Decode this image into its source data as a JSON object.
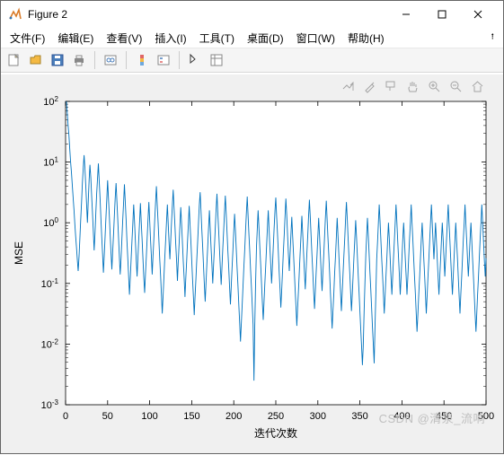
{
  "window": {
    "title": "Figure 2"
  },
  "menu": {
    "file": "文件(F)",
    "edit": "编辑(E)",
    "view": "查看(V)",
    "insert": "插入(I)",
    "tools": "工具(T)",
    "desktop": "桌面(D)",
    "window": "窗口(W)",
    "help": "帮助(H)"
  },
  "watermark": "CSDN @清泉_流响",
  "chart_data": {
    "type": "line",
    "xlabel": "迭代次数",
    "ylabel": "MSE",
    "xlim": [
      0,
      500
    ],
    "ylim_log10": [
      -3,
      2
    ],
    "yticks_log10": [
      -3,
      -2,
      -1,
      0,
      1,
      2
    ],
    "ytick_labels": [
      "10^{-3}",
      "10^{-2}",
      "10^{-1}",
      "10^{0}",
      "10^{1}",
      "10^{2}"
    ],
    "xticks": [
      0,
      50,
      100,
      150,
      200,
      250,
      300,
      350,
      400,
      450,
      500
    ],
    "line_color": "#0072BD",
    "series": {
      "name": "MSE",
      "x": [
        1,
        2,
        3,
        4,
        5,
        6,
        7,
        8,
        9,
        10,
        11,
        12,
        13,
        14,
        15,
        16,
        17,
        18,
        19,
        20,
        21,
        22,
        23,
        24,
        25,
        26,
        27,
        28,
        29,
        30,
        31,
        32,
        33,
        34,
        35,
        36,
        37,
        38,
        39,
        40,
        41,
        42,
        43,
        44,
        45,
        46,
        47,
        48,
        49,
        50,
        51,
        52,
        53,
        54,
        55,
        56,
        57,
        58,
        59,
        60,
        61,
        62,
        63,
        64,
        65,
        66,
        67,
        68,
        69,
        70,
        71,
        72,
        73,
        74,
        75,
        76,
        77,
        78,
        79,
        80,
        81,
        82,
        83,
        84,
        85,
        86,
        87,
        88,
        89,
        90,
        91,
        92,
        93,
        94,
        95,
        96,
        97,
        98,
        99,
        100,
        101,
        102,
        103,
        104,
        105,
        106,
        107,
        108,
        109,
        110,
        111,
        112,
        113,
        114,
        115,
        116,
        117,
        118,
        119,
        120,
        121,
        122,
        123,
        124,
        125,
        126,
        127,
        128,
        129,
        130,
        131,
        132,
        133,
        134,
        135,
        136,
        137,
        138,
        139,
        140,
        141,
        142,
        143,
        144,
        145,
        146,
        147,
        148,
        149,
        150,
        151,
        152,
        153,
        154,
        155,
        156,
        157,
        158,
        159,
        160,
        161,
        162,
        163,
        164,
        165,
        166,
        167,
        168,
        169,
        170,
        171,
        172,
        173,
        174,
        175,
        176,
        177,
        178,
        179,
        180,
        181,
        182,
        183,
        184,
        185,
        186,
        187,
        188,
        189,
        190,
        191,
        192,
        193,
        194,
        195,
        196,
        197,
        198,
        199,
        200,
        201,
        202,
        203,
        204,
        205,
        206,
        207,
        208,
        209,
        210,
        211,
        212,
        213,
        214,
        215,
        216,
        217,
        218,
        219,
        220,
        221,
        222,
        223,
        224,
        225,
        226,
        227,
        228,
        229,
        230,
        231,
        232,
        233,
        234,
        235,
        236,
        237,
        238,
        239,
        240,
        241,
        242,
        243,
        244,
        245,
        246,
        247,
        248,
        249,
        250,
        251,
        252,
        253,
        254,
        255,
        256,
        257,
        258,
        259,
        260,
        261,
        262,
        263,
        264,
        265,
        266,
        267,
        268,
        269,
        270,
        271,
        272,
        273,
        274,
        275,
        276,
        277,
        278,
        279,
        280,
        281,
        282,
        283,
        284,
        285,
        286,
        287,
        288,
        289,
        290,
        291,
        292,
        293,
        294,
        295,
        296,
        297,
        298,
        299,
        300,
        301,
        302,
        303,
        304,
        305,
        306,
        307,
        308,
        309,
        310,
        311,
        312,
        313,
        314,
        315,
        316,
        317,
        318,
        319,
        320,
        321,
        322,
        323,
        324,
        325,
        326,
        327,
        328,
        329,
        330,
        331,
        332,
        333,
        334,
        335,
        336,
        337,
        338,
        339,
        340,
        341,
        342,
        343,
        344,
        345,
        346,
        347,
        348,
        349,
        350,
        351,
        352,
        353,
        354,
        355,
        356,
        357,
        358,
        359,
        360,
        361,
        362,
        363,
        364,
        365,
        366,
        367,
        368,
        369,
        370,
        371,
        372,
        373,
        374,
        375,
        376,
        377,
        378,
        379,
        380,
        381,
        382,
        383,
        384,
        385,
        386,
        387,
        388,
        389,
        390,
        391,
        392,
        393,
        394,
        395,
        396,
        397,
        398,
        399,
        400,
        401,
        402,
        403,
        404,
        405,
        406,
        407,
        408,
        409,
        410,
        411,
        412,
        413,
        414,
        415,
        416,
        417,
        418,
        419,
        420,
        421,
        422,
        423,
        424,
        425,
        426,
        427,
        428,
        429,
        430,
        431,
        432,
        433,
        434,
        435,
        436,
        437,
        438,
        439,
        440,
        441,
        442,
        443,
        444,
        445,
        446,
        447,
        448,
        449,
        450,
        451,
        452,
        453,
        454,
        455,
        456,
        457,
        458,
        459,
        460,
        461,
        462,
        463,
        464,
        465,
        466,
        467,
        468,
        469,
        470,
        471,
        472,
        473,
        474,
        475,
        476,
        477,
        478,
        479,
        480,
        481,
        482,
        483,
        484,
        485,
        486,
        487,
        488,
        489,
        490,
        491,
        492,
        493,
        494,
        495,
        496,
        497,
        498,
        499,
        500
      ],
      "y": [
        100,
        62,
        40,
        28,
        16,
        10,
        6.5,
        4.1,
        2.6,
        1.6,
        0.95,
        0.6,
        0.38,
        0.24,
        0.16,
        0.28,
        0.55,
        1.1,
        2.2,
        4.5,
        8.2,
        13,
        8.0,
        4.0,
        2.0,
        1.0,
        2.4,
        5.0,
        9.0,
        5.5,
        2.8,
        1.4,
        0.7,
        0.35,
        0.7,
        1.5,
        3.0,
        5.5,
        9.5,
        5.0,
        2.5,
        1.2,
        0.6,
        0.3,
        0.15,
        0.3,
        0.6,
        1.2,
        2.5,
        5.0,
        2.6,
        1.3,
        0.65,
        0.33,
        0.17,
        0.33,
        0.65,
        1.3,
        2.5,
        4.5,
        2.3,
        1.2,
        0.55,
        0.27,
        0.14,
        0.27,
        0.55,
        1.1,
        2.2,
        4.3,
        2.1,
        1.1,
        0.5,
        0.25,
        0.13,
        0.065,
        0.13,
        0.26,
        0.5,
        1.0,
        2.0,
        1.0,
        0.5,
        0.25,
        0.13,
        0.26,
        0.52,
        1.05,
        2.1,
        1.05,
        0.52,
        0.26,
        0.13,
        0.07,
        0.14,
        0.28,
        0.56,
        1.1,
        2.2,
        1.1,
        0.55,
        0.28,
        0.14,
        0.28,
        0.56,
        1.1,
        2.2,
        4.0,
        2.0,
        1.0,
        0.5,
        0.25,
        0.13,
        0.065,
        0.032,
        0.065,
        0.13,
        0.26,
        0.52,
        1.0,
        2.0,
        1.0,
        0.5,
        0.25,
        0.5,
        1.0,
        2.0,
        3.5,
        1.8,
        0.9,
        0.45,
        0.23,
        0.11,
        0.23,
        0.46,
        0.92,
        1.8,
        0.92,
        0.46,
        0.23,
        0.12,
        0.06,
        0.12,
        0.24,
        0.48,
        0.96,
        1.9,
        0.96,
        0.48,
        0.24,
        0.12,
        0.06,
        0.03,
        0.06,
        0.12,
        0.24,
        0.48,
        0.96,
        1.9,
        3.2,
        1.6,
        0.8,
        0.4,
        0.2,
        0.1,
        0.05,
        0.1,
        0.2,
        0.4,
        0.8,
        1.6,
        0.8,
        0.4,
        0.2,
        0.1,
        0.2,
        0.4,
        0.8,
        1.6,
        3.0,
        1.5,
        0.74,
        0.37,
        0.19,
        0.095,
        0.19,
        0.38,
        0.76,
        1.5,
        2.8,
        1.4,
        0.7,
        0.35,
        0.18,
        0.09,
        0.045,
        0.09,
        0.18,
        0.36,
        0.72,
        1.4,
        0.72,
        0.36,
        0.18,
        0.09,
        0.045,
        0.022,
        0.011,
        0.022,
        0.045,
        0.09,
        0.18,
        0.36,
        0.72,
        1.4,
        2.7,
        1.35,
        0.68,
        0.34,
        0.17,
        0.085,
        0.043,
        0.021,
        0.0025,
        0.021,
        0.1,
        0.4,
        0.8,
        1.6,
        0.8,
        0.4,
        0.2,
        0.1,
        0.05,
        0.025,
        0.05,
        0.1,
        0.2,
        0.4,
        0.8,
        1.6,
        0.8,
        0.4,
        0.2,
        0.1,
        0.2,
        0.4,
        0.8,
        1.6,
        2.6,
        1.3,
        0.65,
        0.33,
        0.16,
        0.08,
        0.04,
        0.08,
        0.16,
        0.33,
        0.65,
        1.3,
        2.5,
        1.3,
        0.62,
        0.31,
        0.16,
        0.31,
        0.62,
        1.25,
        0.62,
        0.31,
        0.16,
        0.08,
        0.04,
        0.02,
        0.04,
        0.08,
        0.16,
        0.32,
        0.64,
        1.3,
        0.64,
        0.32,
        0.16,
        0.08,
        0.16,
        0.32,
        0.64,
        1.3,
        2.4,
        1.2,
        0.6,
        0.3,
        0.15,
        0.075,
        0.038,
        0.075,
        0.15,
        0.3,
        0.6,
        1.2,
        0.6,
        0.3,
        0.15,
        0.075,
        0.15,
        0.3,
        0.6,
        1.2,
        2.3,
        1.15,
        0.58,
        0.29,
        0.15,
        0.07,
        0.035,
        0.018,
        0.035,
        0.07,
        0.15,
        0.29,
        0.58,
        1.2,
        0.58,
        0.29,
        0.15,
        0.07,
        0.035,
        0.07,
        0.15,
        0.29,
        0.58,
        1.2,
        2.2,
        1.1,
        0.55,
        0.28,
        0.14,
        0.07,
        0.035,
        0.07,
        0.14,
        0.28,
        0.56,
        1.1,
        0.56,
        0.28,
        0.14,
        0.07,
        0.035,
        0.018,
        0.009,
        0.0045,
        0.009,
        0.035,
        0.1,
        0.3,
        0.6,
        1.2,
        0.6,
        0.3,
        0.15,
        0.075,
        0.038,
        0.019,
        0.0095,
        0.0048,
        0.019,
        0.07,
        0.25,
        0.5,
        1.0,
        2.0,
        1.0,
        0.5,
        0.25,
        0.13,
        0.065,
        0.032,
        0.065,
        0.13,
        0.26,
        0.52,
        1.0,
        0.52,
        0.26,
        0.13,
        0.065,
        0.13,
        0.26,
        0.52,
        1.0,
        2.0,
        1.0,
        0.5,
        0.25,
        0.13,
        0.065,
        0.13,
        0.26,
        0.52,
        1.0,
        0.52,
        0.26,
        0.13,
        0.065,
        0.13,
        0.26,
        0.52,
        1.0,
        2.0,
        1.0,
        0.5,
        0.25,
        0.13,
        0.065,
        0.032,
        0.016,
        0.032,
        0.065,
        0.13,
        0.26,
        0.52,
        1.0,
        0.52,
        0.26,
        0.13,
        0.065,
        0.032,
        0.065,
        0.13,
        0.26,
        0.52,
        1.0,
        2.0,
        1.0,
        0.5,
        0.25,
        0.5,
        1.0,
        0.5,
        0.25,
        0.13,
        0.065,
        0.13,
        0.26,
        0.52,
        1.0,
        0.52,
        0.26,
        0.13,
        0.26,
        0.52,
        1.0,
        2.0,
        1.0,
        0.5,
        0.25,
        0.13,
        0.065,
        0.13,
        0.26,
        0.52,
        1.0,
        0.52,
        0.26,
        0.13,
        0.065,
        0.032,
        0.065,
        0.13,
        0.26,
        0.52,
        1.0,
        2.0,
        1.0,
        0.5,
        0.25,
        0.13,
        0.26,
        0.52,
        1.0,
        0.52,
        0.26,
        0.13,
        0.065,
        0.032,
        0.016,
        0.032,
        0.065,
        0.13,
        0.26,
        0.52,
        1.0,
        2.0,
        1.0,
        0.5,
        0.25,
        0.13,
        0.26,
        0.52,
        1.0,
        0.52,
        0.26,
        0.13,
        0.065
      ]
    }
  }
}
